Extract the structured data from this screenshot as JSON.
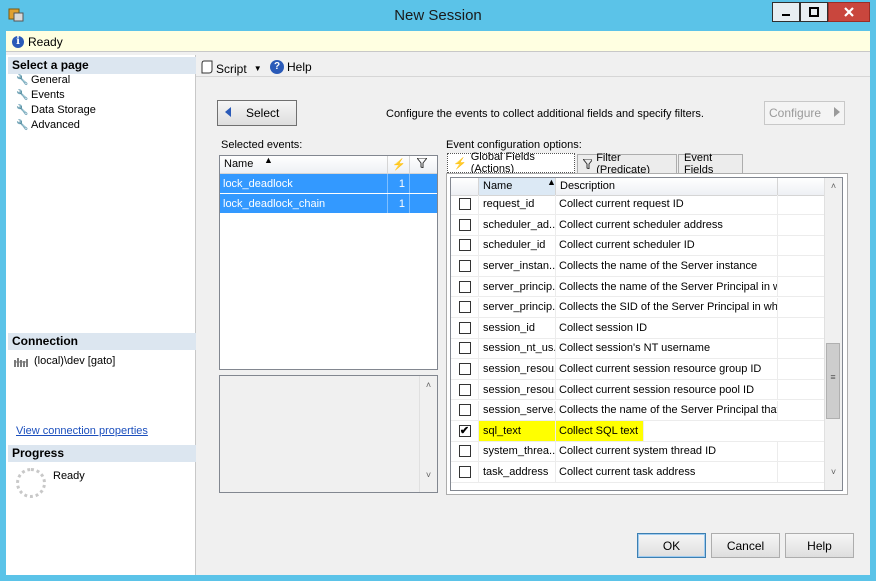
{
  "window": {
    "title": "New Session"
  },
  "status": {
    "text": "Ready"
  },
  "left": {
    "select_page_header": "Select a page",
    "pages": [
      "General",
      "Events",
      "Data Storage",
      "Advanced"
    ],
    "connection_header": "Connection",
    "connection_value": "(local)\\dev [gato]",
    "view_connection_link": "View connection properties",
    "progress_header": "Progress",
    "progress_status": "Ready"
  },
  "toolbar": {
    "script_label": "Script",
    "help_label": "Help"
  },
  "events_page": {
    "select_button": "Select",
    "configure_hint": "Configure the events to collect additional fields and specify filters.",
    "configure_button": "Configure",
    "selected_events_label": "Selected events:",
    "options_label": "Event configuration options:",
    "grid_name_header": "Name",
    "selected_events": [
      {
        "name": "lock_deadlock",
        "count": "1"
      },
      {
        "name": "lock_deadlock_chain",
        "count": "1"
      }
    ],
    "tabs": [
      "Global Fields (Actions)",
      "Filter (Predicate)",
      "Event Fields"
    ],
    "fields_header_name": "Name",
    "fields_header_desc": "Description",
    "fields": [
      {
        "name": "request_id",
        "desc": "Collect current request ID",
        "checked": false
      },
      {
        "name": "scheduler_ad...",
        "desc": "Collect current scheduler address",
        "checked": false
      },
      {
        "name": "scheduler_id",
        "desc": "Collect current scheduler ID",
        "checked": false
      },
      {
        "name": "server_instan...",
        "desc": "Collects the name of the Server instance",
        "checked": false
      },
      {
        "name": "server_princip...",
        "desc": "Collects the name of the Server Principal in who...",
        "checked": false
      },
      {
        "name": "server_princip...",
        "desc": "Collects the SID of the Server Principal in whos...",
        "checked": false
      },
      {
        "name": "session_id",
        "desc": "Collect session ID",
        "checked": false
      },
      {
        "name": "session_nt_us...",
        "desc": "Collect session's NT username",
        "checked": false
      },
      {
        "name": "session_resou...",
        "desc": "Collect current session resource group ID",
        "checked": false
      },
      {
        "name": "session_resou...",
        "desc": "Collect current session resource pool ID",
        "checked": false
      },
      {
        "name": "session_serve...",
        "desc": "Collects the name of the Server Principal that ori...",
        "checked": false
      },
      {
        "name": "sql_text",
        "desc": "Collect SQL text",
        "checked": true
      },
      {
        "name": "system_threa...",
        "desc": "Collect current system thread ID",
        "checked": false
      },
      {
        "name": "task_address",
        "desc": "Collect current task address",
        "checked": false
      }
    ]
  },
  "buttons": {
    "ok": "OK",
    "cancel": "Cancel",
    "help": "Help"
  },
  "colors": {
    "title_bar": "#5bc3e8",
    "selection": "#3399ff",
    "highlight": "#ffff00",
    "link": "#1b4fbd"
  }
}
